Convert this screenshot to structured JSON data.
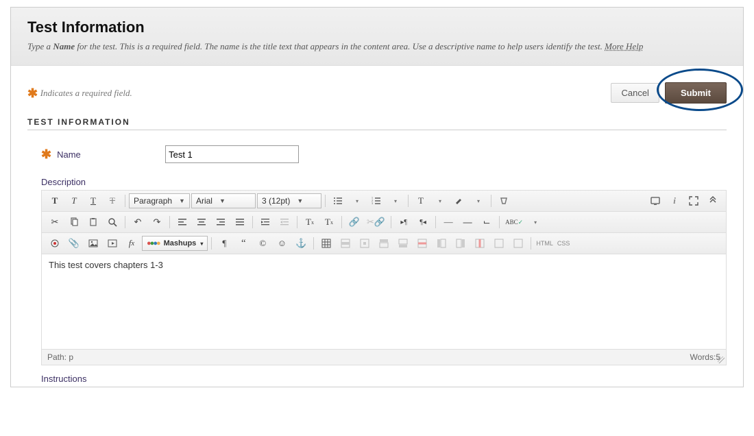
{
  "header": {
    "title": "Test Information",
    "help_text_prefix": "Type a ",
    "help_text_bold": "Name",
    "help_text_suffix": " for the test. This is a required field. The name is the title text that appears in the content area. Use a descriptive name to help users identify the test. ",
    "more_help": "More Help"
  },
  "required_note": "Indicates a required field.",
  "buttons": {
    "cancel": "Cancel",
    "submit": "Submit"
  },
  "section_title": "TEST INFORMATION",
  "fields": {
    "name_label": "Name",
    "name_value": "Test 1",
    "description_label": "Description",
    "instructions_label": "Instructions"
  },
  "editor": {
    "format_dd": "Paragraph",
    "font_dd": "Arial",
    "size_dd": "3 (12pt)",
    "mashups_label": "Mashups",
    "html_label": "HTML",
    "css_label": "CSS",
    "content": "This test covers chapters 1-3",
    "path": "Path: p",
    "words": "Words:5"
  }
}
